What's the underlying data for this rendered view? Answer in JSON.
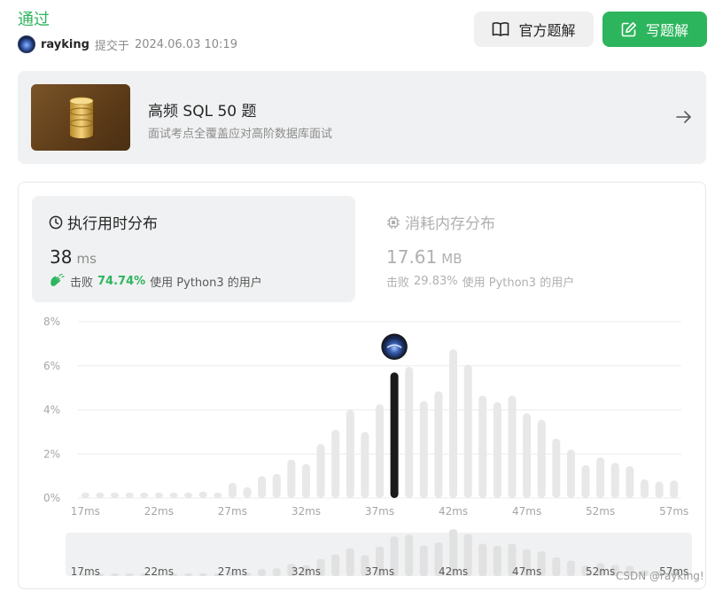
{
  "header": {
    "status": "通过",
    "user": "rayking",
    "submitted_prefix": "提交于",
    "submitted_time": "2024.06.03 10:19",
    "btn_solution": "官方题解",
    "btn_write": "写题解"
  },
  "study_plan": {
    "title": "高频 SQL 50 题",
    "subtitle": "面试考点全覆盖应对高阶数据库面试"
  },
  "runtime": {
    "label": "执行用时分布",
    "value": "38",
    "unit": "ms",
    "beat_prefix": "击败",
    "beat_pct": "74.74%",
    "beat_suffix": "使用 Python3 的用户"
  },
  "memory": {
    "label": "消耗内存分布",
    "value": "17.61",
    "unit": "MB",
    "beat_prefix": "击败",
    "beat_pct": "29.83%",
    "beat_suffix": "使用 Python3 的用户"
  },
  "watermark": "CSDN @rayking!",
  "colors": {
    "accent_green": "#2db55d",
    "bar_grey": "#e8e8e8",
    "bar_selected": "#1a1a1a"
  },
  "chart_data": {
    "type": "bar",
    "yticks": [
      "8%",
      "6%",
      "4%",
      "2%",
      "0%"
    ],
    "ylim": [
      0,
      8
    ],
    "xticks": [
      "17ms",
      "22ms",
      "27ms",
      "32ms",
      "37ms",
      "42ms",
      "47ms",
      "52ms",
      "57ms"
    ],
    "x": [
      17,
      18,
      19,
      20,
      21,
      22,
      23,
      24,
      25,
      26,
      27,
      28,
      29,
      30,
      31,
      32,
      33,
      34,
      35,
      36,
      37,
      38,
      39,
      40,
      41,
      42,
      43,
      44,
      45,
      46,
      47,
      48,
      49,
      50,
      51,
      52,
      53,
      54,
      55,
      56,
      57
    ],
    "values": [
      0.25,
      0.25,
      0.25,
      0.25,
      0.25,
      0.25,
      0.25,
      0.25,
      0.3,
      0.25,
      0.7,
      0.5,
      1.0,
      1.1,
      1.75,
      1.55,
      2.45,
      3.1,
      4.0,
      3.0,
      4.25,
      5.7,
      5.95,
      4.4,
      4.85,
      6.75,
      6.05,
      4.65,
      4.35,
      4.65,
      3.85,
      3.55,
      2.7,
      2.2,
      1.5,
      1.85,
      1.6,
      1.45,
      0.85,
      0.75,
      0.8
    ],
    "selected_x": 38,
    "grid": true,
    "overview": {
      "xticks": [
        "17ms",
        "22ms",
        "27ms",
        "32ms",
        "37ms",
        "42ms",
        "47ms",
        "52ms",
        "57ms"
      ]
    }
  }
}
